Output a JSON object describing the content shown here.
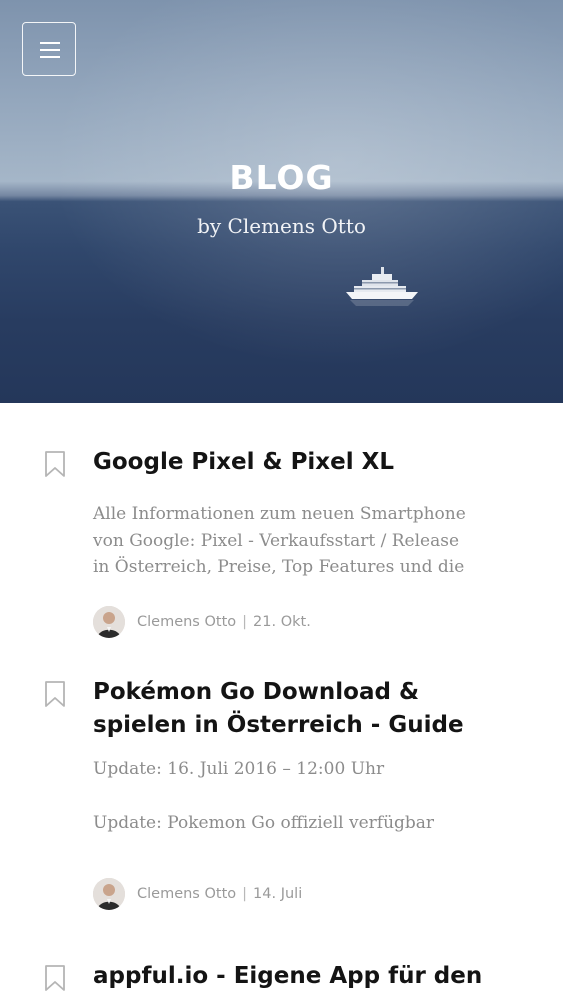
{
  "hero": {
    "title": "BLOG",
    "subtitle": "by Clemens Otto"
  },
  "nav": {
    "menu_icon": "hamburger-menu-icon"
  },
  "posts": [
    {
      "title": "Google Pixel & Pixel XL",
      "excerpt": [
        "Alle Informationen zum neuen Smartphone",
        "von Google: Pixel - Verkaufsstart / Release",
        "in Österreich, Preise, Top Features und die"
      ],
      "author": "Clemens Otto",
      "date": "21. Okt."
    },
    {
      "title_lines": [
        "Pokémon Go Download &",
        "spielen in Österreich - Guide"
      ],
      "paragraphs": [
        "Update: 16. Juli 2016 – 12:00 Uhr",
        "Update: Pokemon Go offiziell verfügbar"
      ],
      "author": "Clemens Otto",
      "date": "14. Juli"
    },
    {
      "title": "appful.io - Eigene App für den"
    }
  ],
  "meta_separator": "|",
  "icons": {
    "bookmark": "bookmark-icon",
    "avatar": "author-avatar"
  }
}
